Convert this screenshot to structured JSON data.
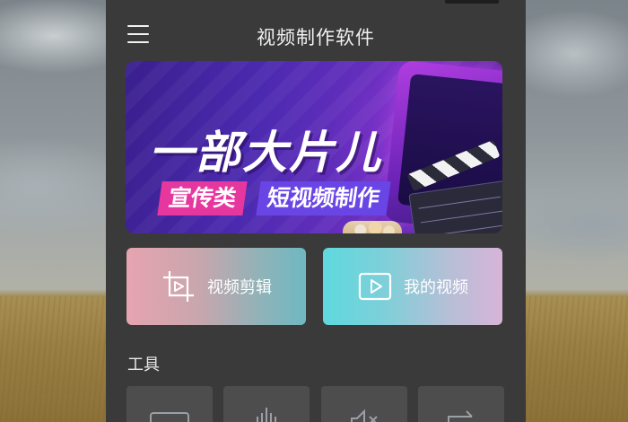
{
  "app": {
    "title": "视频制作软件"
  },
  "banner": {
    "headline": "一部大片儿",
    "tag_left": "宣传类",
    "tag_right": "短视频制作"
  },
  "actions": [
    {
      "label": "视频剪辑",
      "icon": "crop-play-icon"
    },
    {
      "label": "我的视频",
      "icon": "play-box-icon"
    }
  ],
  "tools": {
    "section_label": "工具",
    "items": [
      {
        "icon": "gif-icon"
      },
      {
        "icon": "audio-waveform-icon"
      },
      {
        "icon": "mute-icon"
      },
      {
        "icon": "convert-loop-icon"
      }
    ]
  },
  "colors": {
    "panel": "#3a3a3a",
    "card_edit_start": "#e6a4b0",
    "card_edit_end": "#6fb8c2",
    "card_mine_start": "#5ed9de",
    "card_mine_end": "#d7b4d8",
    "banner_purple": "#4c2ab0",
    "tag_pink": "#e6379f",
    "tag_violet": "#6a45e6"
  }
}
